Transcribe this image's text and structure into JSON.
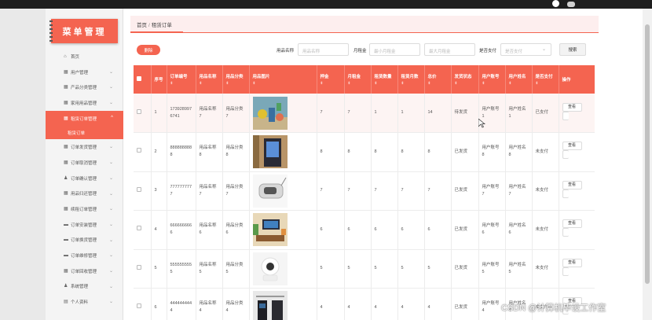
{
  "app": {
    "logo_text": "菜单管理",
    "brand_color": "#f46450"
  },
  "sidebar": {
    "items": [
      {
        "icon": "home-icon",
        "glyph": "⌂",
        "label": "首页",
        "has_chevron": false
      },
      {
        "icon": "users-icon",
        "glyph": "▦",
        "label": "用户管理",
        "has_chevron": true
      },
      {
        "icon": "category-icon",
        "glyph": "▦",
        "label": "产品分类管理",
        "has_chevron": true
      },
      {
        "icon": "goods-icon",
        "glyph": "▦",
        "label": "家用用品管理",
        "has_chevron": true
      },
      {
        "icon": "order-icon",
        "glyph": "▦",
        "label": "租赁订单管理",
        "has_chevron": true,
        "active": true
      },
      {
        "icon": "ship-icon",
        "glyph": "▦",
        "label": "订单发货管理",
        "has_chevron": true
      },
      {
        "icon": "cancel-icon",
        "glyph": "▦",
        "label": "订单取消管理",
        "has_chevron": true
      },
      {
        "icon": "confirm-icon",
        "glyph": "♟",
        "label": "订单确认管理",
        "has_chevron": true
      },
      {
        "icon": "return-icon",
        "glyph": "▦",
        "label": "用品归还管理",
        "has_chevron": true
      },
      {
        "icon": "renew-icon",
        "glyph": "▦",
        "label": "续租订单管理",
        "has_chevron": true
      },
      {
        "icon": "install-icon",
        "glyph": "▬",
        "label": "订单安装管理",
        "has_chevron": true
      },
      {
        "icon": "exchange-icon",
        "glyph": "▬",
        "label": "订单换货管理",
        "has_chevron": true
      },
      {
        "icon": "repair-icon",
        "glyph": "▬",
        "label": "订单维修管理",
        "has_chevron": true
      },
      {
        "icon": "recycle-icon",
        "glyph": "▦",
        "label": "订单回收管理",
        "has_chevron": true
      },
      {
        "icon": "system-icon",
        "glyph": "♟",
        "label": "系统管理",
        "has_chevron": true
      },
      {
        "icon": "profile-icon",
        "glyph": "▤",
        "label": "个人资料",
        "has_chevron": true
      }
    ],
    "active_sub": "租赁订单"
  },
  "breadcrumb": {
    "home": "首页",
    "separator": "/",
    "current": "租赁订单"
  },
  "toolbar": {
    "delete_label": "删除",
    "name_label": "用品名称",
    "name_placeholder": "用品名称",
    "rent_label": "月租金",
    "rent_min_placeholder": "最小月租金",
    "rent_max_placeholder": "最大月租金",
    "paid_label": "是否支付",
    "paid_placeholder": "是否支付",
    "search_label": "搜索"
  },
  "table": {
    "columns": [
      "序号",
      "订单编号",
      "用品名称",
      "用品分类",
      "用品图片",
      "押金",
      "月租金",
      "租赁数量",
      "租赁月数",
      "总价",
      "发货状态",
      "用户账号",
      "用户姓名",
      "是否支付",
      "操作"
    ],
    "sortable": [
      false,
      true,
      true,
      true,
      true,
      true,
      true,
      true,
      true,
      true,
      true,
      true,
      true,
      true,
      false
    ],
    "view_label": "查看",
    "rows": [
      {
        "idx": "1",
        "order": "1739289976741",
        "name": "用品名称7",
        "cat": "用品分类7",
        "img": "img-toys",
        "deposit": "7",
        "rent": "7",
        "qty": "1",
        "months": "1",
        "total": "14",
        "ship": "待发货",
        "account": "用户账号1",
        "uname": "用户姓名1",
        "paid": "已支付"
      },
      {
        "idx": "2",
        "order": "8888888888",
        "name": "用品名称8",
        "cat": "用品分类8",
        "img": "img-device",
        "deposit": "8",
        "rent": "8",
        "qty": "8",
        "months": "8",
        "total": "8",
        "ship": "已发货",
        "account": "用户账号8",
        "uname": "用户姓名8",
        "paid": "未支付"
      },
      {
        "idx": "3",
        "order": "7777777777",
        "name": "用品名称7",
        "cat": "用品分类7",
        "img": "img-robot",
        "deposit": "7",
        "rent": "7",
        "qty": "7",
        "months": "7",
        "total": "7",
        "ship": "已发货",
        "account": "用户账号7",
        "uname": "用户姓名7",
        "paid": "未支付"
      },
      {
        "idx": "4",
        "order": "6666666666",
        "name": "用品名称6",
        "cat": "用品分类6",
        "img": "img-room",
        "deposit": "6",
        "rent": "6",
        "qty": "6",
        "months": "6",
        "total": "6",
        "ship": "已发货",
        "account": "用户账号6",
        "uname": "用户姓名6",
        "paid": "未支付"
      },
      {
        "idx": "5",
        "order": "5555555555",
        "name": "用品名称5",
        "cat": "用品分类5",
        "img": "img-camera",
        "deposit": "5",
        "rent": "5",
        "qty": "5",
        "months": "5",
        "total": "5",
        "ship": "已发货",
        "account": "用户账号5",
        "uname": "用户姓名5",
        "paid": "未支付"
      },
      {
        "idx": "6",
        "order": "4444444444",
        "name": "用品名称4",
        "cat": "用品分类4",
        "img": "img-panel",
        "deposit": "4",
        "rent": "4",
        "qty": "4",
        "months": "4",
        "total": "4",
        "ship": "已发货",
        "account": "用户账号4",
        "uname": "用户姓名4",
        "paid": "未支付"
      }
    ]
  },
  "watermark": "CSDN @计算机毕设工作室"
}
